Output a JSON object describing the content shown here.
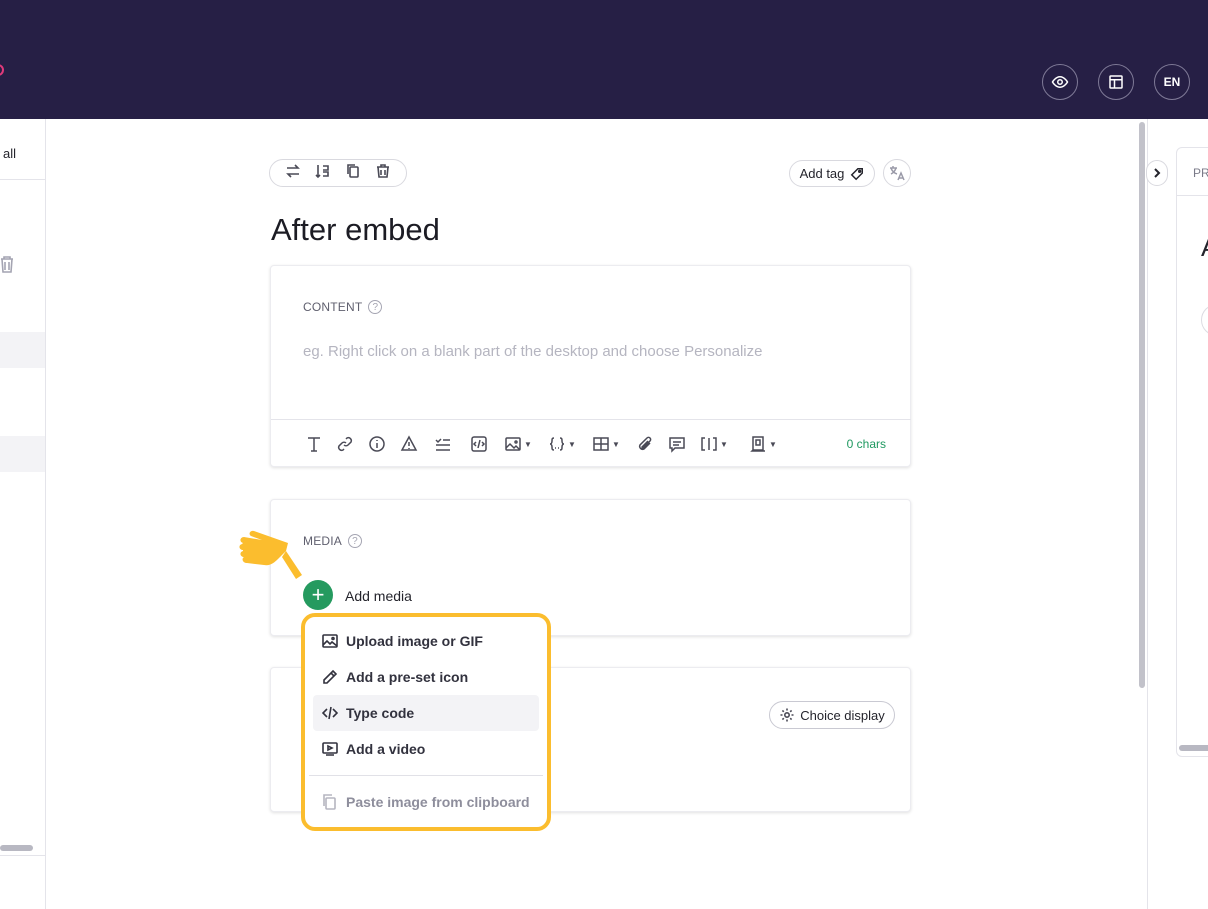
{
  "header": {
    "preview_label": "preview",
    "layout_label": "layout",
    "language": "EN"
  },
  "left_panel": {
    "partial_text": "all"
  },
  "right_panel": {
    "partial_header": "PR",
    "partial_char": "A"
  },
  "step": {
    "title": "After embed",
    "add_tag_label": "Add tag"
  },
  "content_card": {
    "label": "CONTENT",
    "help": "?",
    "placeholder": "eg. Right click on a blank part of the desktop and choose Personalize",
    "char_count": "0 chars"
  },
  "media_card": {
    "label": "MEDIA",
    "help": "?",
    "add_media_label": "Add media",
    "add_media_symbol": "+"
  },
  "choices_card": {
    "choice_display_label": "Choice display"
  },
  "media_menu": {
    "items": [
      {
        "label": "Upload image or GIF",
        "icon": "image-icon"
      },
      {
        "label": "Add a pre-set icon",
        "icon": "pencil-icon"
      },
      {
        "label": "Type code",
        "icon": "code-icon"
      },
      {
        "label": "Add a video",
        "icon": "video-icon"
      },
      {
        "label": "Paste image from clipboard",
        "icon": "clipboard-icon"
      }
    ]
  },
  "colors": {
    "topbar": "#261f45",
    "accent_green": "#259a5f",
    "highlight": "#fbbd2e"
  }
}
